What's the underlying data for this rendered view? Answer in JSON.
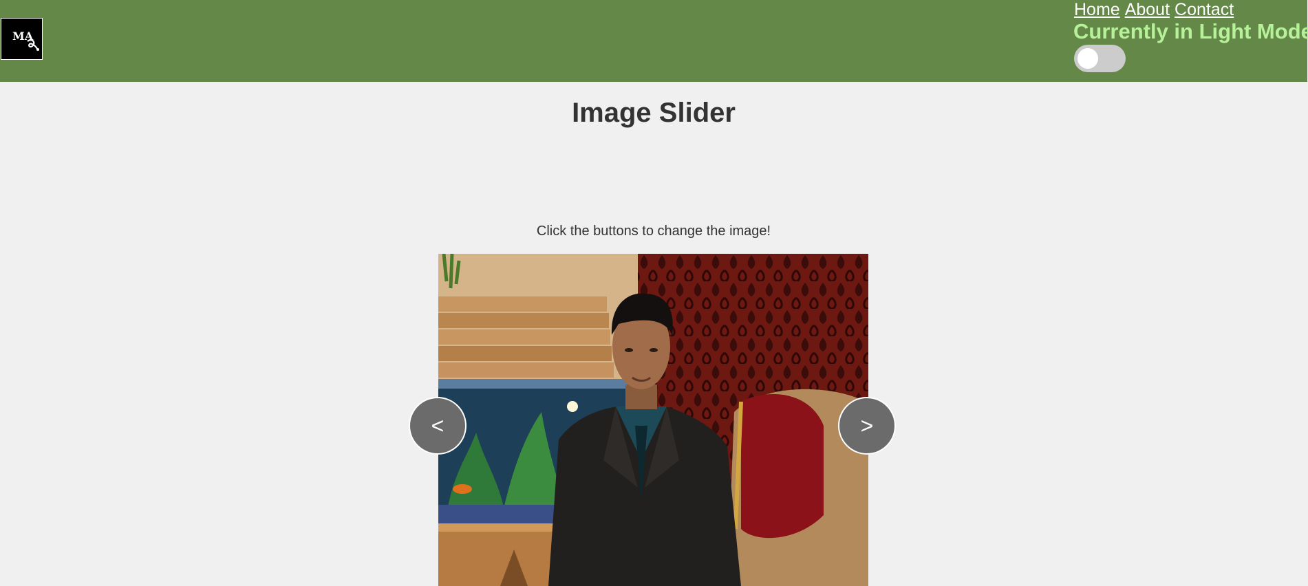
{
  "header": {
    "logo_text": "MA",
    "nav": [
      "Home",
      "About",
      "Contact"
    ],
    "mode_label": "Currently in Light Mode",
    "toggle_on": false
  },
  "colors": {
    "header_bg": "#648848",
    "mode_label": "#b7f29a",
    "page_bg": "#f0f0f0",
    "button_bg": "#6b6b6b"
  },
  "main": {
    "title": "Image Slider",
    "instructions": "Click the buttons to change the image!",
    "prev_label": "<",
    "next_label": ">"
  },
  "icons": {
    "logo": "ma-monogram-logo",
    "toggle": "theme-toggle-switch"
  }
}
